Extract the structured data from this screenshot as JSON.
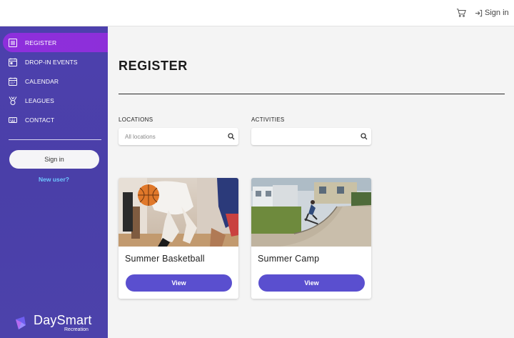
{
  "header": {
    "cart_icon": "cart-icon",
    "signin_label": "Sign in"
  },
  "sidebar": {
    "items": [
      {
        "label": "REGISTER",
        "icon": "list-icon",
        "active": true
      },
      {
        "label": "DROP-IN EVENTS",
        "icon": "calendar-event-icon",
        "active": false
      },
      {
        "label": "CALENDAR",
        "icon": "calendar-icon",
        "active": false
      },
      {
        "label": "LEAGUES",
        "icon": "medal-icon",
        "active": false
      },
      {
        "label": "CONTACT",
        "icon": "keyboard-icon",
        "active": false
      }
    ],
    "signin_button": "Sign in",
    "new_user_link": "New user?",
    "brand": {
      "name": "DaySmart",
      "sub": "Recreation"
    }
  },
  "main": {
    "title": "REGISTER",
    "filters": {
      "locations": {
        "label": "LOCATIONS",
        "placeholder": "All locations",
        "value": ""
      },
      "activities": {
        "label": "ACTIVITIES",
        "placeholder": "",
        "value": ""
      }
    },
    "cards": [
      {
        "title": "Summer Basketball",
        "button": "View",
        "image": "basketball-photo"
      },
      {
        "title": "Summer Camp",
        "button": "View",
        "image": "skatepark-photo"
      }
    ]
  },
  "colors": {
    "sidebar": "#4b40aa",
    "active_item": "#8d2fd9",
    "view_button": "#5a4fcf",
    "new_user_link": "#6ec6ff"
  }
}
